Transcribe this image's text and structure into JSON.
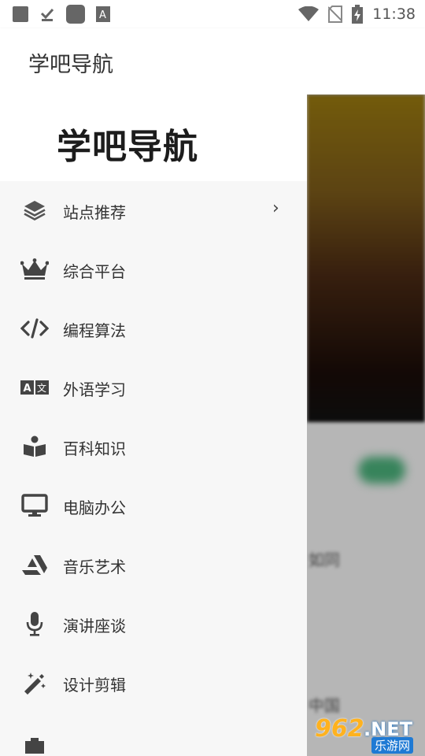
{
  "status": {
    "time": "11:38"
  },
  "app_bar": {
    "title": "学吧导航"
  },
  "drawer": {
    "logo": "学吧导航",
    "items": [
      {
        "label": "站点推荐",
        "icon": "layers-icon",
        "has_chevron": true
      },
      {
        "label": "综合平台",
        "icon": "crown-icon"
      },
      {
        "label": "编程算法",
        "icon": "code-icon"
      },
      {
        "label": "外语学习",
        "icon": "translate-icon"
      },
      {
        "label": "百科知识",
        "icon": "reader-icon"
      },
      {
        "label": "电脑办公",
        "icon": "monitor-icon"
      },
      {
        "label": "音乐艺术",
        "icon": "artstation-icon"
      },
      {
        "label": "演讲座谈",
        "icon": "microphone-icon"
      },
      {
        "label": "设计剪辑",
        "icon": "magic-wand-icon"
      }
    ],
    "chevron": "›"
  },
  "background": {
    "text1": "如同",
    "text2": "中国"
  },
  "watermark": {
    "number": "962",
    "suffix": ".NET",
    "site": "乐游网"
  },
  "colors": {
    "accent": "#4ab07a",
    "watermark_orange": "#ffb21f",
    "watermark_blue": "#1f7ad4"
  }
}
